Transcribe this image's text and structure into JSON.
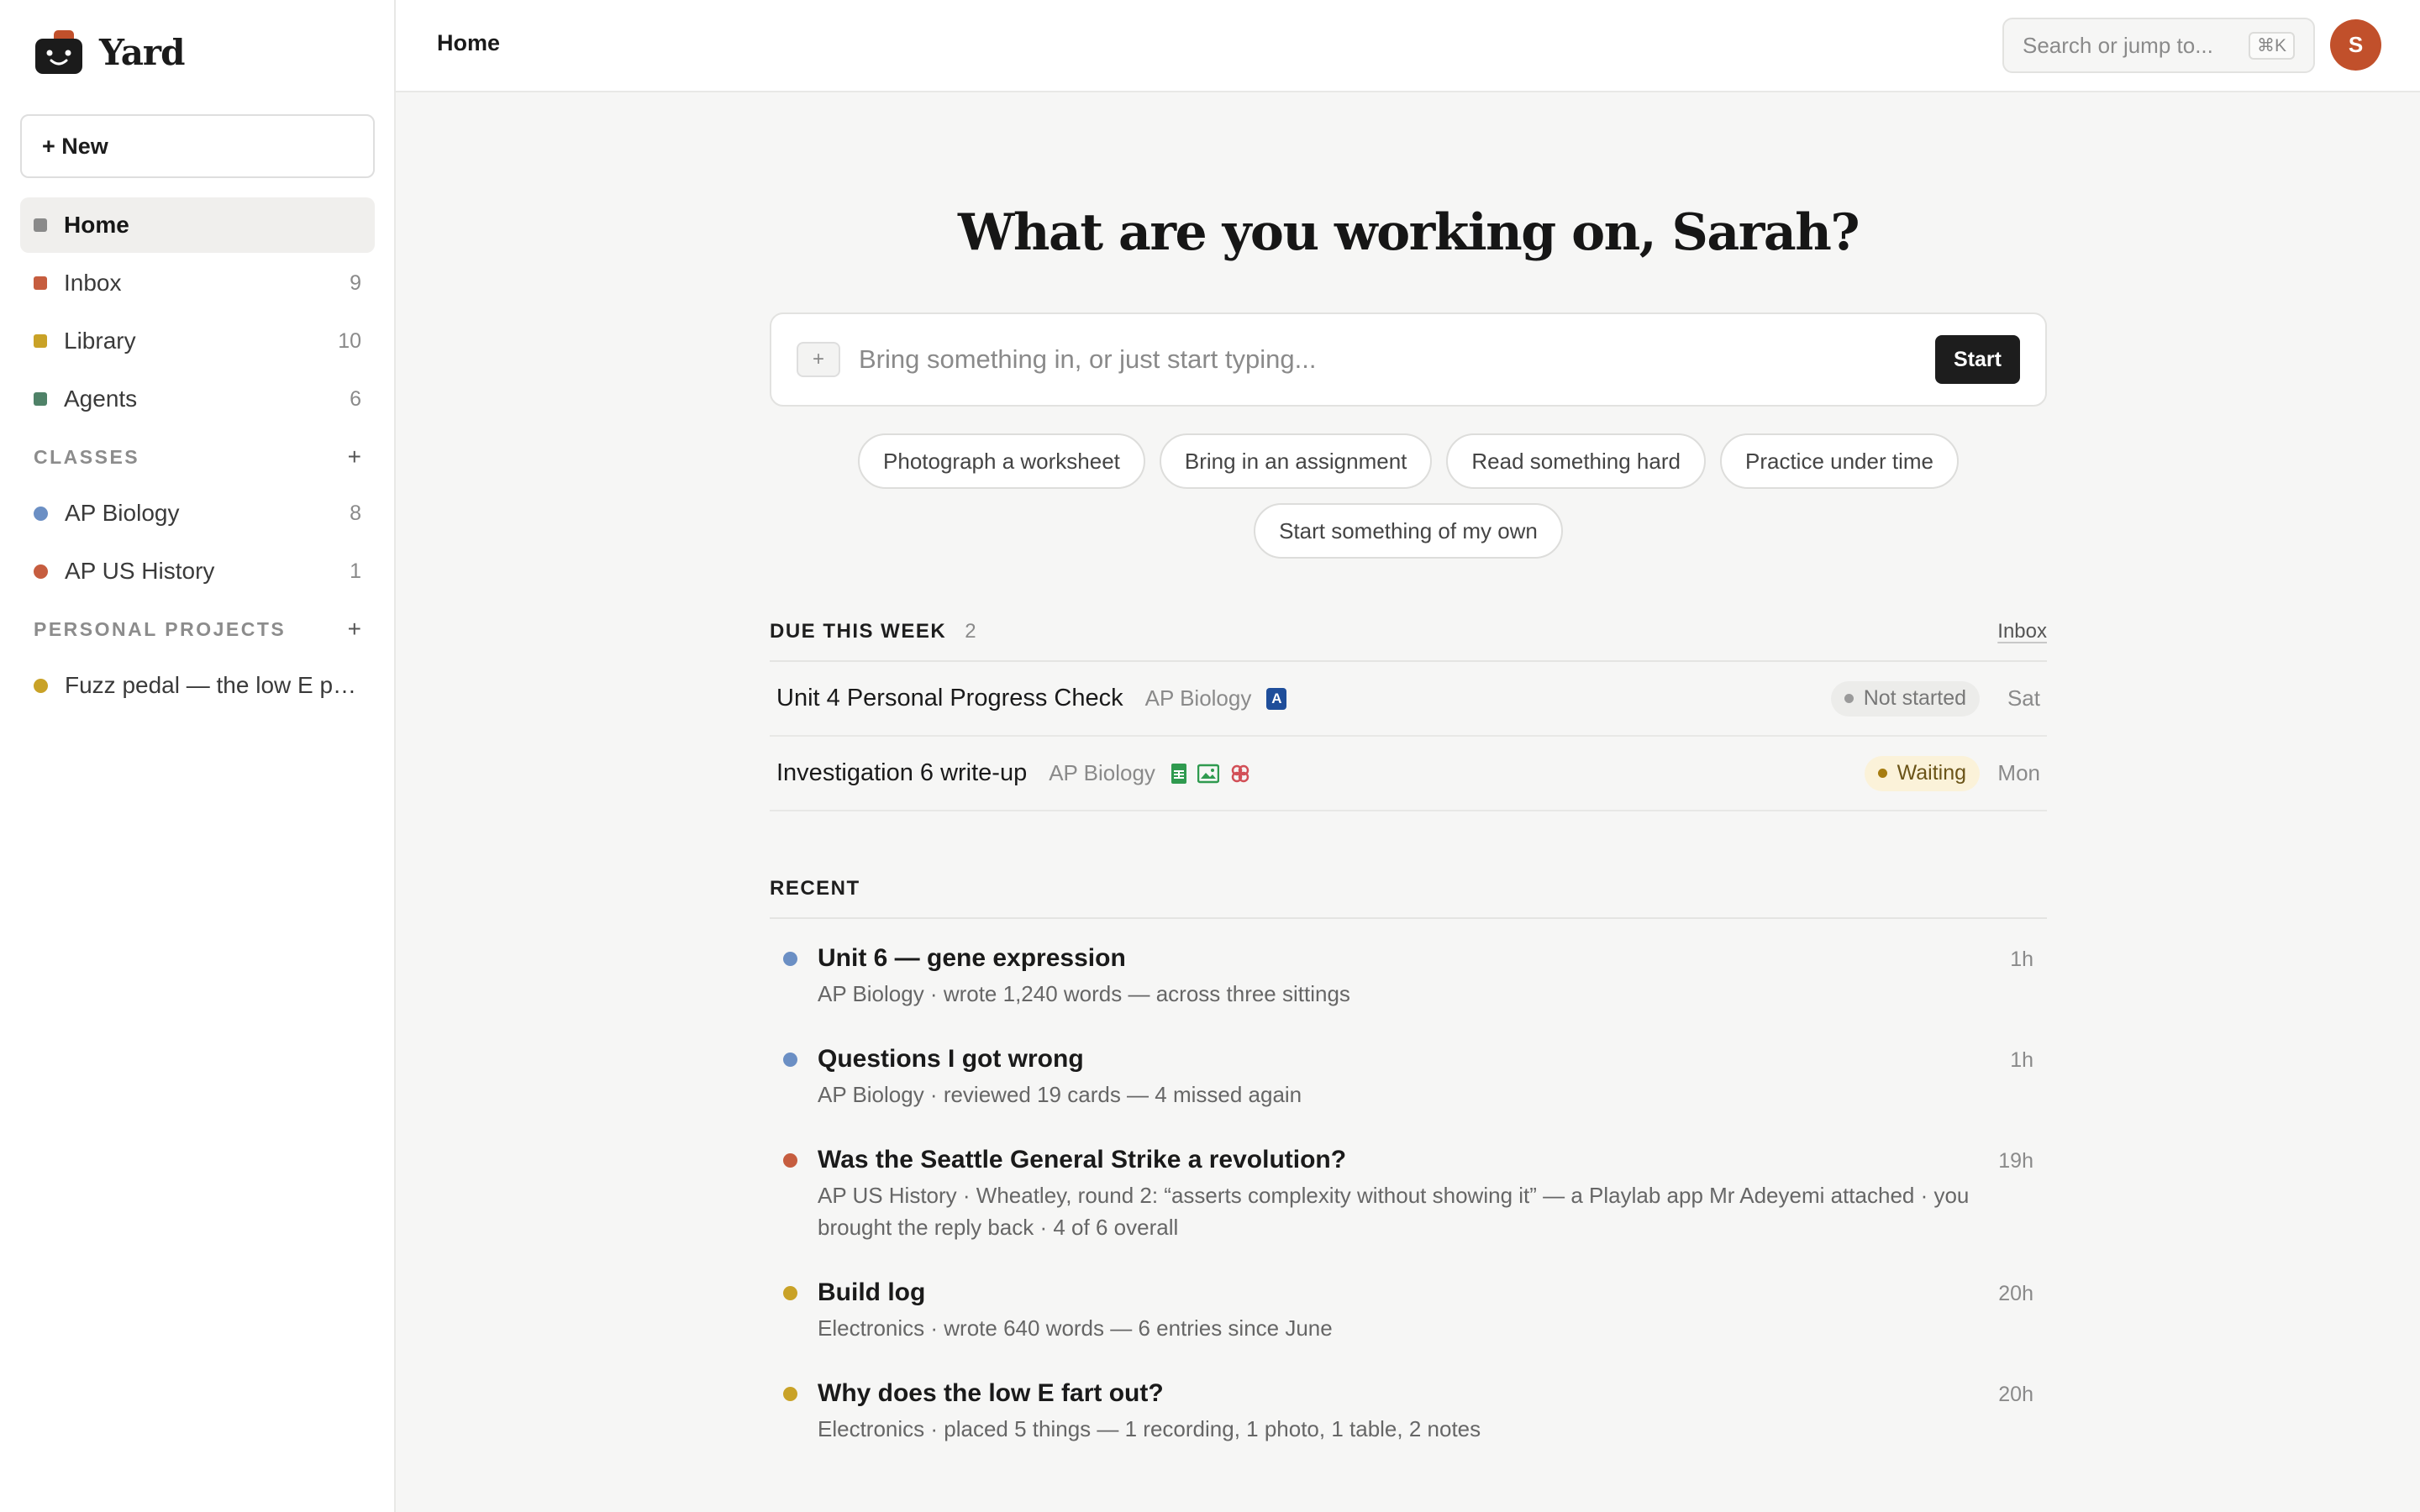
{
  "app": {
    "name": "Yard",
    "colors": {
      "brand": "#c1502b",
      "ink": "#1d1d1d"
    }
  },
  "sidebar": {
    "new_label": "+ New",
    "nav": [
      {
        "label": "Home",
        "count": "",
        "color": "#8a8a8a",
        "active": true
      },
      {
        "label": "Inbox",
        "count": "9",
        "color": "#c65d3f"
      },
      {
        "label": "Library",
        "count": "10",
        "color": "#c9a227"
      },
      {
        "label": "Agents",
        "count": "6",
        "color": "#4f8268"
      }
    ],
    "classes": {
      "heading": "CLASSES",
      "add": "+",
      "items": [
        {
          "label": "AP Biology",
          "count": "8",
          "color": "#6b8fc4"
        },
        {
          "label": "AP US History",
          "count": "1",
          "color": "#c65d3f"
        }
      ]
    },
    "projects": {
      "heading": "PERSONAL PROJECTS",
      "add": "+",
      "items": [
        {
          "label": "Fuzz pedal — the low E pro...",
          "color": "#c9a227"
        }
      ]
    }
  },
  "topbar": {
    "breadcrumb": "Home",
    "search_placeholder": "Search or jump to...",
    "search_shortcut": "⌘K",
    "avatar_initial": "S"
  },
  "main": {
    "greeting": "What are you working on, Sarah?",
    "composer": {
      "attach_icon": "+",
      "placeholder": "Bring something in, or just start typing...",
      "start_label": "Start"
    },
    "chips": [
      "Photograph a worksheet",
      "Bring in an assignment",
      "Read something hard",
      "Practice under time",
      "Start something of my own"
    ],
    "due": {
      "heading": "DUE THIS WEEK",
      "count": "2",
      "link": "Inbox",
      "rows": [
        {
          "title": "Unit 4 Personal Progress Check",
          "class": "AP Biology",
          "badge": "A",
          "status": "Not started",
          "day": "Sat"
        },
        {
          "title": "Investigation 6 write-up",
          "class": "AP Biology",
          "icons": [
            "sheet-icon",
            "image-icon",
            "link-icon"
          ],
          "status": "Waiting",
          "day": "Mon"
        }
      ]
    },
    "recent": {
      "heading": "RECENT",
      "items": [
        {
          "title": "Unit 6 — gene expression",
          "sub": "AP Biology · wrote 1,240 words — across three sittings",
          "time": "1h",
          "color": "#6b8fc4"
        },
        {
          "title": "Questions I got wrong",
          "sub": "AP Biology · reviewed 19 cards — 4 missed again",
          "time": "1h",
          "color": "#6b8fc4"
        },
        {
          "title": "Was the Seattle General Strike a revolution?",
          "sub": "AP US History · Wheatley, round 2: “asserts complexity without showing it” — a Playlab app Mr Adeyemi attached · you brought the reply back · 4 of 6 overall",
          "time": "19h",
          "color": "#c65d3f"
        },
        {
          "title": "Build log",
          "sub": "Electronics · wrote 640 words — 6 entries since June",
          "time": "20h",
          "color": "#c9a227"
        },
        {
          "title": "Why does the low E fart out?",
          "sub": "Electronics · placed 5 things — 1 recording, 1 photo, 1 table, 2 notes",
          "time": "20h",
          "color": "#c9a227"
        }
      ]
    }
  }
}
